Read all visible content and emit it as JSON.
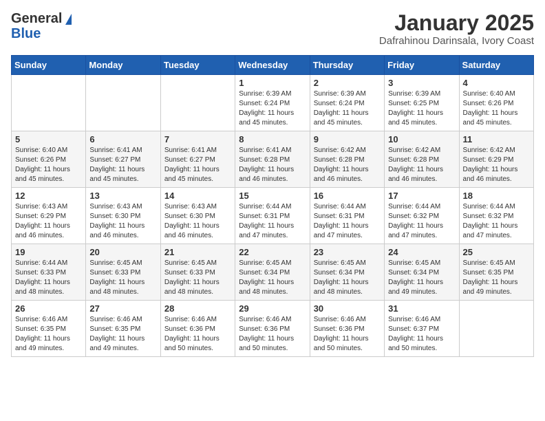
{
  "header": {
    "logo_general": "General",
    "logo_blue": "Blue",
    "month_title": "January 2025",
    "subtitle": "Dafrahinou Darinsala, Ivory Coast"
  },
  "days_of_week": [
    "Sunday",
    "Monday",
    "Tuesday",
    "Wednesday",
    "Thursday",
    "Friday",
    "Saturday"
  ],
  "weeks": [
    [
      {
        "day": "",
        "info": ""
      },
      {
        "day": "",
        "info": ""
      },
      {
        "day": "",
        "info": ""
      },
      {
        "day": "1",
        "info": "Sunrise: 6:39 AM\nSunset: 6:24 PM\nDaylight: 11 hours and 45 minutes."
      },
      {
        "day": "2",
        "info": "Sunrise: 6:39 AM\nSunset: 6:24 PM\nDaylight: 11 hours and 45 minutes."
      },
      {
        "day": "3",
        "info": "Sunrise: 6:39 AM\nSunset: 6:25 PM\nDaylight: 11 hours and 45 minutes."
      },
      {
        "day": "4",
        "info": "Sunrise: 6:40 AM\nSunset: 6:26 PM\nDaylight: 11 hours and 45 minutes."
      }
    ],
    [
      {
        "day": "5",
        "info": "Sunrise: 6:40 AM\nSunset: 6:26 PM\nDaylight: 11 hours and 45 minutes."
      },
      {
        "day": "6",
        "info": "Sunrise: 6:41 AM\nSunset: 6:27 PM\nDaylight: 11 hours and 45 minutes."
      },
      {
        "day": "7",
        "info": "Sunrise: 6:41 AM\nSunset: 6:27 PM\nDaylight: 11 hours and 45 minutes."
      },
      {
        "day": "8",
        "info": "Sunrise: 6:41 AM\nSunset: 6:28 PM\nDaylight: 11 hours and 46 minutes."
      },
      {
        "day": "9",
        "info": "Sunrise: 6:42 AM\nSunset: 6:28 PM\nDaylight: 11 hours and 46 minutes."
      },
      {
        "day": "10",
        "info": "Sunrise: 6:42 AM\nSunset: 6:28 PM\nDaylight: 11 hours and 46 minutes."
      },
      {
        "day": "11",
        "info": "Sunrise: 6:42 AM\nSunset: 6:29 PM\nDaylight: 11 hours and 46 minutes."
      }
    ],
    [
      {
        "day": "12",
        "info": "Sunrise: 6:43 AM\nSunset: 6:29 PM\nDaylight: 11 hours and 46 minutes."
      },
      {
        "day": "13",
        "info": "Sunrise: 6:43 AM\nSunset: 6:30 PM\nDaylight: 11 hours and 46 minutes."
      },
      {
        "day": "14",
        "info": "Sunrise: 6:43 AM\nSunset: 6:30 PM\nDaylight: 11 hours and 46 minutes."
      },
      {
        "day": "15",
        "info": "Sunrise: 6:44 AM\nSunset: 6:31 PM\nDaylight: 11 hours and 47 minutes."
      },
      {
        "day": "16",
        "info": "Sunrise: 6:44 AM\nSunset: 6:31 PM\nDaylight: 11 hours and 47 minutes."
      },
      {
        "day": "17",
        "info": "Sunrise: 6:44 AM\nSunset: 6:32 PM\nDaylight: 11 hours and 47 minutes."
      },
      {
        "day": "18",
        "info": "Sunrise: 6:44 AM\nSunset: 6:32 PM\nDaylight: 11 hours and 47 minutes."
      }
    ],
    [
      {
        "day": "19",
        "info": "Sunrise: 6:44 AM\nSunset: 6:33 PM\nDaylight: 11 hours and 48 minutes."
      },
      {
        "day": "20",
        "info": "Sunrise: 6:45 AM\nSunset: 6:33 PM\nDaylight: 11 hours and 48 minutes."
      },
      {
        "day": "21",
        "info": "Sunrise: 6:45 AM\nSunset: 6:33 PM\nDaylight: 11 hours and 48 minutes."
      },
      {
        "day": "22",
        "info": "Sunrise: 6:45 AM\nSunset: 6:34 PM\nDaylight: 11 hours and 48 minutes."
      },
      {
        "day": "23",
        "info": "Sunrise: 6:45 AM\nSunset: 6:34 PM\nDaylight: 11 hours and 48 minutes."
      },
      {
        "day": "24",
        "info": "Sunrise: 6:45 AM\nSunset: 6:34 PM\nDaylight: 11 hours and 49 minutes."
      },
      {
        "day": "25",
        "info": "Sunrise: 6:45 AM\nSunset: 6:35 PM\nDaylight: 11 hours and 49 minutes."
      }
    ],
    [
      {
        "day": "26",
        "info": "Sunrise: 6:46 AM\nSunset: 6:35 PM\nDaylight: 11 hours and 49 minutes."
      },
      {
        "day": "27",
        "info": "Sunrise: 6:46 AM\nSunset: 6:35 PM\nDaylight: 11 hours and 49 minutes."
      },
      {
        "day": "28",
        "info": "Sunrise: 6:46 AM\nSunset: 6:36 PM\nDaylight: 11 hours and 50 minutes."
      },
      {
        "day": "29",
        "info": "Sunrise: 6:46 AM\nSunset: 6:36 PM\nDaylight: 11 hours and 50 minutes."
      },
      {
        "day": "30",
        "info": "Sunrise: 6:46 AM\nSunset: 6:36 PM\nDaylight: 11 hours and 50 minutes."
      },
      {
        "day": "31",
        "info": "Sunrise: 6:46 AM\nSunset: 6:37 PM\nDaylight: 11 hours and 50 minutes."
      },
      {
        "day": "",
        "info": ""
      }
    ]
  ]
}
